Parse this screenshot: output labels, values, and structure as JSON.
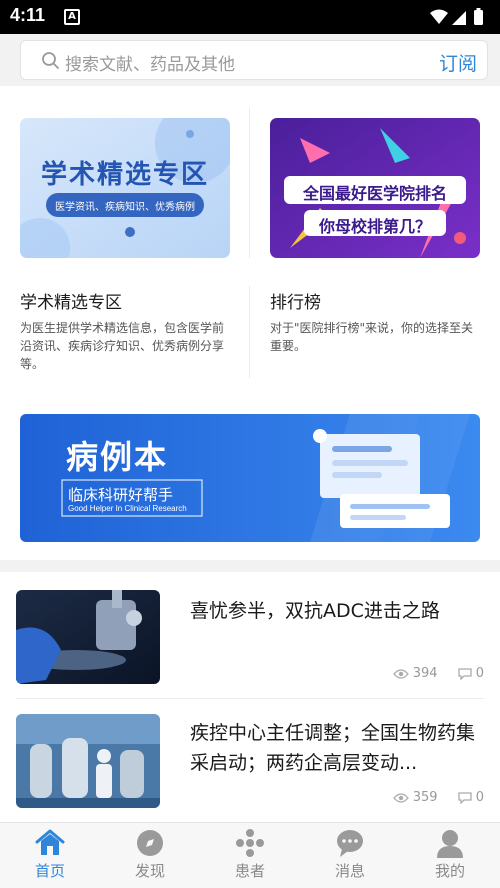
{
  "status_bar": {
    "time": "4:11",
    "notif_letter": "A"
  },
  "search": {
    "placeholder": "搜索文献、药品及其他",
    "subscribe_label": "订阅"
  },
  "cards": [
    {
      "image_title": "学术精选专区",
      "image_caption": "医学资讯、疾病知识、优秀病例",
      "title": "学术精选专区",
      "description": "为医生提供学术精选信息，包含医学前沿资讯、疾病诊疗知识、优秀病例分享等。"
    },
    {
      "image_line1": "全国最好医学院排名",
      "image_line2": "你母校排第几？",
      "title": "排行榜",
      "description": "对于\"医院排行榜\"来说，你的选择至关重要。"
    }
  ],
  "banner": {
    "title": "病例本",
    "subtitle": "临床科研好帮手",
    "subtitle_en": "Good Helper In Clinical Research"
  },
  "articles": [
    {
      "title": "喜忧参半，双抗ADC进击之路",
      "views": "394",
      "comments": "0"
    },
    {
      "title": "疾控中心主任调整；全国生物药集采启动；两药企高层变动...",
      "views": "359",
      "comments": "0"
    }
  ],
  "nav": {
    "items": [
      {
        "label": "首页",
        "icon": "home-icon",
        "active": true
      },
      {
        "label": "发现",
        "icon": "compass-icon",
        "active": false
      },
      {
        "label": "患者",
        "icon": "patients-icon",
        "active": false
      },
      {
        "label": "消息",
        "icon": "message-icon",
        "active": false
      },
      {
        "label": "我的",
        "icon": "profile-icon",
        "active": false
      }
    ]
  },
  "colors": {
    "accent": "#2e86d8",
    "inactive": "#8a8a8a"
  }
}
